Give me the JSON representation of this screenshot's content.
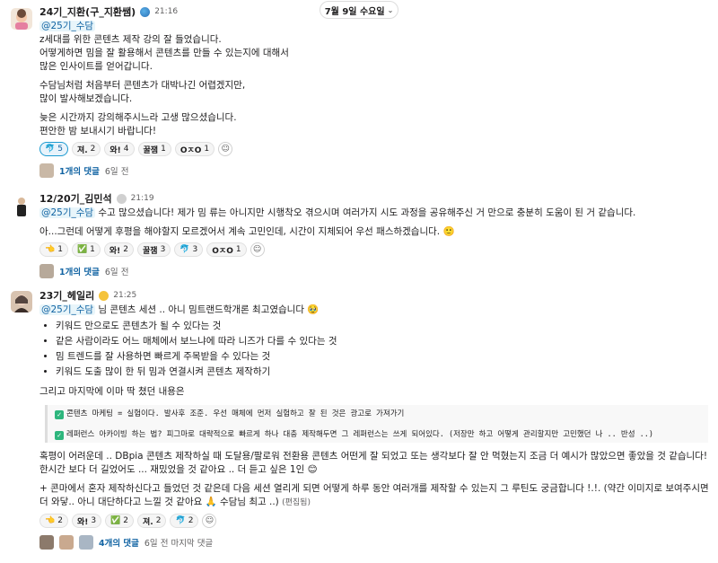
{
  "date_pill": {
    "label": "7월 9일 수요일"
  },
  "messages": [
    {
      "name": "24기_지환(구_지환쌤)",
      "time": "21:16",
      "mention": "@25기_수담",
      "lines": [
        "z세대를 위한 콘텐츠 제작 강의 잘 들었습니다.",
        "어떻게하면 밈을 잘 활용해서 콘텐츠를 만들 수 있는지에 대해서",
        "많은 인사이트를 얻어갑니다.",
        "수담님처럼 처음부터 콘텐츠가 대박나긴 어렵겠지만,",
        "많이 발사해보겠습니다.",
        "늦은 시간까지 강의해주시느라 고생 많으셨습니다.",
        "편안한 밤 보내시기 바랍니다!"
      ],
      "reactions": [
        {
          "emoji": "🐬",
          "count": "5",
          "mine": true
        },
        {
          "emoji": "져.",
          "count": "2",
          "mine": false
        },
        {
          "emoji": "와!",
          "count": "4",
          "mine": false
        },
        {
          "emoji": "꿀잼",
          "count": "1",
          "mine": false
        },
        {
          "emoji": "OㅈO",
          "count": "1",
          "mine": false
        }
      ],
      "reply_count": "1개의 댓글",
      "reply_when": "6일 전"
    },
    {
      "name": "12/20기_김민석",
      "time": "21:19",
      "mention": "@25기_수담",
      "line1_rest": " 수고 많으셨습니다! 제가 밈 류는 아니지만 시행착오 겪으시며 여러가지 시도 과정을 공유해주신 거 만으로 충분히 도움이 된 거 같습니다.",
      "line2": "아...그런데 어떻게 후평을 해야할지 모르겠어서 계속 고민인데, 시간이 지체되어 우선 패스하겠습니다. 🙂",
      "reactions": [
        {
          "emoji": "👈",
          "count": "1",
          "mine": false
        },
        {
          "emoji": "✅",
          "count": "1",
          "mine": false
        },
        {
          "emoji": "와!",
          "count": "2",
          "mine": false
        },
        {
          "emoji": "꿀잼",
          "count": "3",
          "mine": false
        },
        {
          "emoji": "🐬",
          "count": "3",
          "mine": false
        },
        {
          "emoji": "OㅈO",
          "count": "1",
          "mine": false
        }
      ],
      "reply_count": "1개의 댓글",
      "reply_when": "6일 전"
    },
    {
      "name": "23기_헤일리",
      "time": "21:25",
      "mention": "@25기_수담",
      "line1_rest": " 님 콘텐츠 세션 .. 아니 밈트랜드학개론 최고였습니다 🥹",
      "bullets": [
        "키워드 만으로도 콘텐츠가 될 수 있다는 것",
        "같은 사람이라도 어느 매체에서 보느냐에 따라 니즈가 다를 수 있다는 것",
        "밈 트렌드를 잘 사용하면 빠르게 주목받을 수 있다는 것",
        "키워드 도출 많이 한 뒤 밈과 연결시켜 콘텐츠 제작하기"
      ],
      "intro": "그리고 마지막에 이마 딱 쳤던 내용은",
      "quote": [
        "콘텐츠 마케팅 = 실험이다. 발사후 조준. 우선 매체에 먼저 실험하고 잘 된 것은 광고로 가져가기",
        "레퍼런스 아카이빙 하는 법? 피그마로 대략적으로 빠르게 하나 대충 제작해두면 그 레퍼런스는 쓰게 되어있다. (저장만 하고 어떻게 관리할지만 고민했던 나 .. 반성 ..)"
      ],
      "p1": [
        "혹평이 어려운데 .. DBpia 콘텐츠 제작하실 때 도달용/팔로워 전환용 콘텐츠 어떤게 잘 되었고 또는 생각보다 잘 안 먹혔는지 조금 더 예시가 많았으면 좋았을 것 같습니다!",
        "한시간 보다 더 길었어도 ... 재밌었을 것 같아요 .. 더 듣고 싶은 1인 😊"
      ],
      "p2": [
        "+ 콘마에서 혼자 제작하신다고 들었던 것 같은데 다음 세션 열리게 되면 어떻게 하루 동안 여러개를 제작할 수 있는지 그 루틴도 궁금합니다 !.!. (약간 이미지로 보여주시면",
        "더 와닿.. 아니 대단하다고 느낄 것 같아요 🙏 수담님 최고 ..)"
      ],
      "edited": "(편집됨)",
      "reactions": [
        {
          "emoji": "👈",
          "count": "2",
          "mine": false
        },
        {
          "emoji": "와!",
          "count": "3",
          "mine": false
        },
        {
          "emoji": "✅",
          "count": "2",
          "mine": false
        },
        {
          "emoji": "져.",
          "count": "2",
          "mine": false
        },
        {
          "emoji": "🐬",
          "count": "2",
          "mine": false
        }
      ],
      "reply_count": "4개의 댓글",
      "reply_when": "6일 전 마지막 댓글"
    }
  ],
  "colors": {
    "accent": "#1264a3",
    "mention_bg": "#e8f5fa",
    "check": "#2eb67d"
  }
}
